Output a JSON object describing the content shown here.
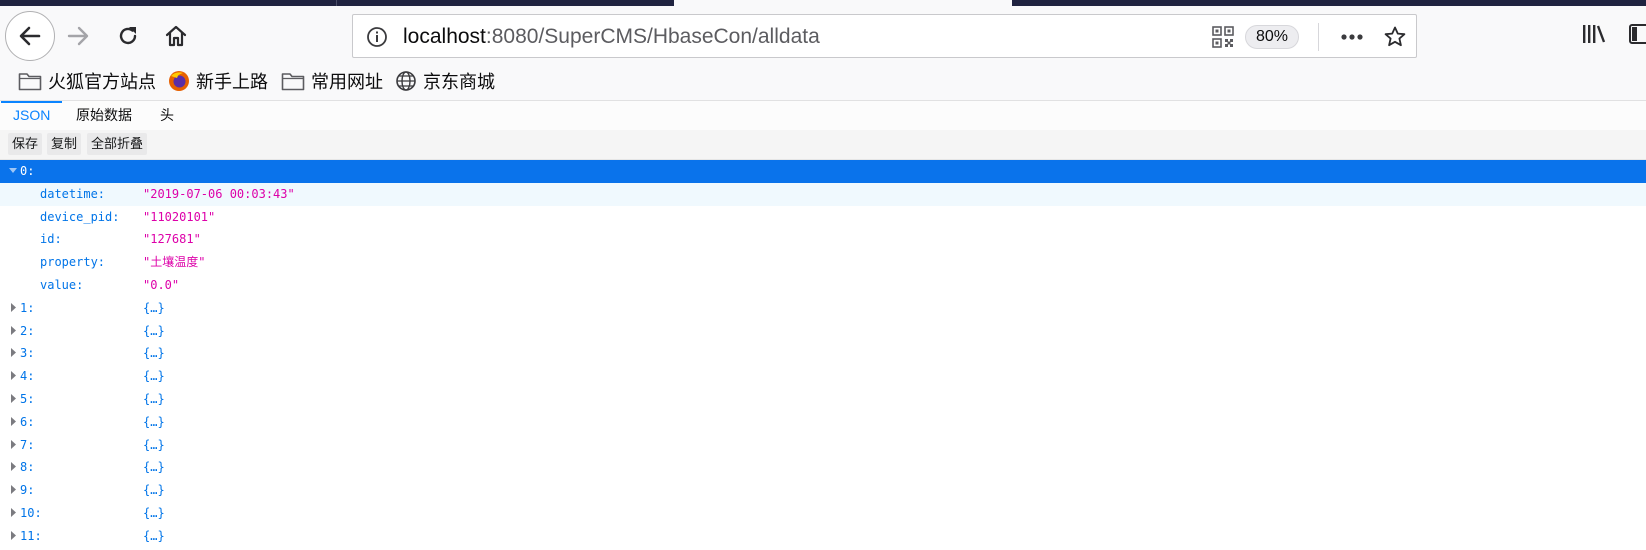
{
  "browser": {
    "url_host": "localhost",
    "url_rest": ":8080/SuperCMS/HbaseCon/alldata",
    "zoom": "80%",
    "icons": {
      "back": "back-arrow-icon",
      "forward": "forward-arrow-icon",
      "reload": "reload-icon",
      "home": "home-icon",
      "info": "info-icon",
      "qr": "qr-code-icon",
      "more": "more-icon",
      "star": "star-icon",
      "library": "library-icon",
      "sidebar": "sidebar-icon"
    }
  },
  "bookmarks": [
    {
      "label": "火狐官方站点",
      "icon": "folder-icon"
    },
    {
      "label": "新手上路",
      "icon": "firefox-icon"
    },
    {
      "label": "常用网址",
      "icon": "folder-icon"
    },
    {
      "label": "京东商城",
      "icon": "globe-icon"
    }
  ],
  "viewer": {
    "tabs": [
      "JSON",
      "原始数据",
      "头"
    ],
    "active_tab": "JSON",
    "toolbar": [
      "保存",
      "复制",
      "全部折叠"
    ]
  },
  "tree": {
    "expanded_key": "0:",
    "fields": [
      {
        "key": "datetime:",
        "value": "\"2019-07-06 00:03:43\""
      },
      {
        "key": "device_pid:",
        "value": "\"11020101\""
      },
      {
        "key": "id:",
        "value": "\"127681\""
      },
      {
        "key": "property:",
        "value": "\"土壤温度\""
      },
      {
        "key": "value:",
        "value": "\"0.0\""
      }
    ],
    "collapsed": [
      {
        "key": "1:",
        "value": "{…}"
      },
      {
        "key": "2:",
        "value": "{…}"
      },
      {
        "key": "3:",
        "value": "{…}"
      },
      {
        "key": "4:",
        "value": "{…}"
      },
      {
        "key": "5:",
        "value": "{…}"
      },
      {
        "key": "6:",
        "value": "{…}"
      },
      {
        "key": "7:",
        "value": "{…}"
      },
      {
        "key": "8:",
        "value": "{…}"
      },
      {
        "key": "9:",
        "value": "{…}"
      },
      {
        "key": "10:",
        "value": "{…}"
      },
      {
        "key": "11:",
        "value": "{…}"
      }
    ]
  },
  "colors": {
    "selected_row": "#0a73eb",
    "key": "#0074e8",
    "string": "#dd00a9",
    "active_tab": "#0a84ff"
  }
}
